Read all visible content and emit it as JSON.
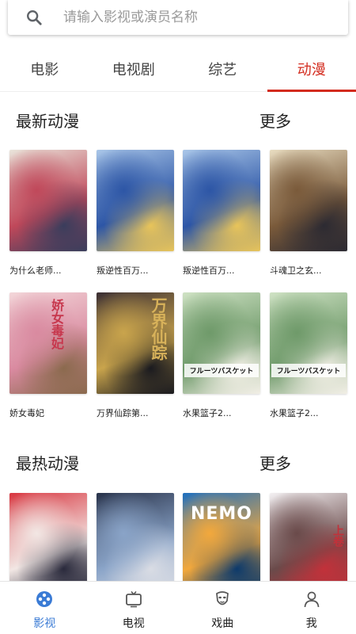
{
  "search": {
    "placeholder": "请输入影视或演员名称",
    "value": ""
  },
  "tabs": [
    {
      "label": "电影",
      "active": false
    },
    {
      "label": "电视剧",
      "active": false
    },
    {
      "label": "综艺",
      "active": false
    },
    {
      "label": "动漫",
      "active": true
    }
  ],
  "sections": [
    {
      "title": "最新动漫",
      "more": "更多",
      "items": [
        {
          "title": "为什么老师...",
          "palette": [
            "#e9e4da",
            "#c0485a",
            "#3a3d5c"
          ]
        },
        {
          "title": "叛逆性百万...",
          "palette": [
            "#a9c6e8",
            "#2d56a6",
            "#e8c45a"
          ]
        },
        {
          "title": "叛逆性百万...",
          "palette": [
            "#a9c6e8",
            "#2d56a6",
            "#e8c45a"
          ]
        },
        {
          "title": "斗魂卫之玄...",
          "palette": [
            "#e8dcc0",
            "#7a5a3a",
            "#2c2a32"
          ]
        },
        {
          "title": "娇女毒妃",
          "palette": [
            "#f3d6d9",
            "#d98aa0",
            "#8b6a4e"
          ]
        },
        {
          "title": "万界仙踪第...",
          "palette": [
            "#3a2e33",
            "#c9a44c",
            "#1a1a1f"
          ]
        },
        {
          "title": "水果篮子2...",
          "palette": [
            "#cfe2c4",
            "#6f9a6a",
            "#f2efe6"
          ]
        },
        {
          "title": "水果篮子2...",
          "palette": [
            "#cfe2c4",
            "#6f9a6a",
            "#f2efe6"
          ]
        }
      ]
    },
    {
      "title": "最热动漫",
      "more": "更多",
      "items": [
        {
          "title": "",
          "palette": [
            "#d8353f",
            "#f2e7e4",
            "#2a2a3c"
          ]
        },
        {
          "title": "",
          "palette": [
            "#28324a",
            "#8aa4c8",
            "#d9dce4"
          ]
        },
        {
          "title": "",
          "palette": [
            "#1e6fbf",
            "#f2a83c",
            "#0d3a6b"
          ]
        },
        {
          "title": "",
          "palette": [
            "#f3f0f2",
            "#6a4a4a",
            "#c2313a"
          ]
        }
      ]
    }
  ],
  "poster_text": {
    "s0i4": "娇女毒妃",
    "s0i5": "万界仙踪",
    "s0i6": "フルーツバスケット",
    "s0i7": "フルーツバスケット",
    "s1i2": "NEMO",
    "s1i3": "上卷"
  },
  "bottom_nav": [
    {
      "label": "影视",
      "icon": "film-reel-icon",
      "active": true
    },
    {
      "label": "电视",
      "icon": "tv-icon",
      "active": false
    },
    {
      "label": "戏曲",
      "icon": "opera-mask-icon",
      "active": false
    },
    {
      "label": "我",
      "icon": "person-icon",
      "active": false
    }
  ],
  "colors": {
    "accent": "#d32b1e",
    "nav_active": "#3a7bd5"
  }
}
